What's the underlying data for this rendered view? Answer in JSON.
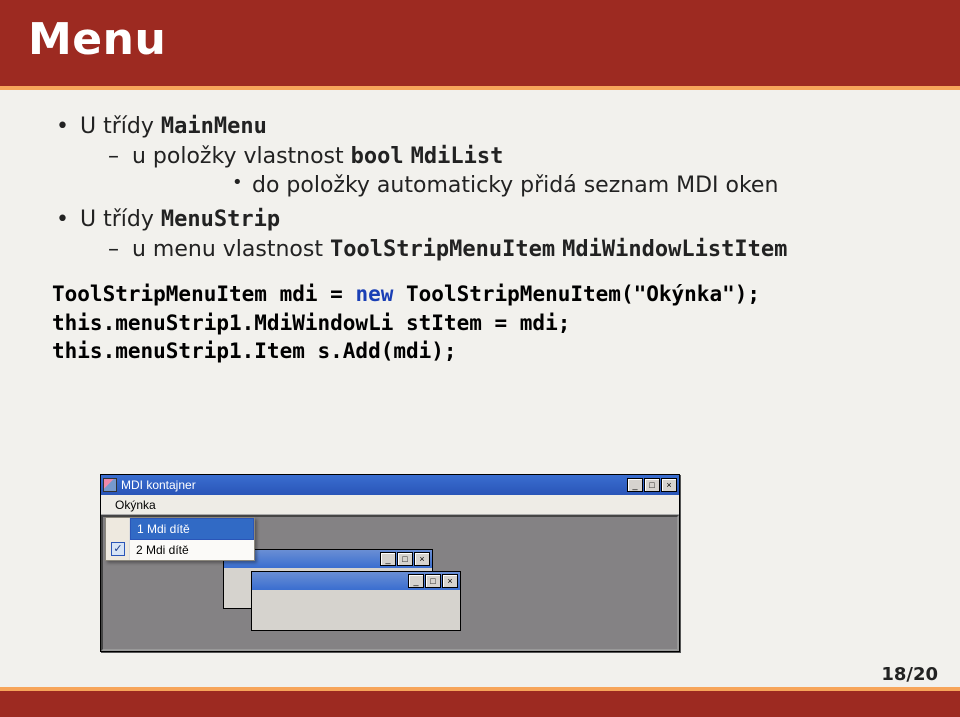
{
  "slide": {
    "title": "Menu",
    "page": "18/20"
  },
  "bullets": {
    "b1_pre": "U třídy ",
    "b1_class": "MainMenu",
    "b1_d1_pre": "u položky vlastnost ",
    "b1_d1_type": "bool",
    "b1_d1_sp": " ",
    "b1_d1_prop": "MdiList",
    "b1_d1_s1": "do položky automaticky přidá seznam MDI oken",
    "b2_pre": "U třídy ",
    "b2_class": "MenuStrip",
    "b2_d1_pre": "u menu vlastnost ",
    "b2_d1_type": "ToolStripMenuItem",
    "b2_d1_sp": " ",
    "b2_d1_prop": "MdiWindowListItem"
  },
  "code": {
    "l1a": "ToolStripMenuItem mdi = ",
    "l1kw": "new",
    "l1b": " ToolStripMenuItem(\"Okýnka\");",
    "l2": "this.menuStrip1.MdiWindowLi stItem = mdi;",
    "l3": "this.menuStrip1.Item s.Add(mdi);"
  },
  "mock": {
    "window_title": "MDI kontajner",
    "menu_label": "Okýnka",
    "dropdown": {
      "item1": "1 Mdi dítě",
      "item2": "2 Mdi dítě"
    },
    "btn_min": "_",
    "btn_max": "□",
    "btn_close": "×",
    "check_glyph": "✓"
  }
}
